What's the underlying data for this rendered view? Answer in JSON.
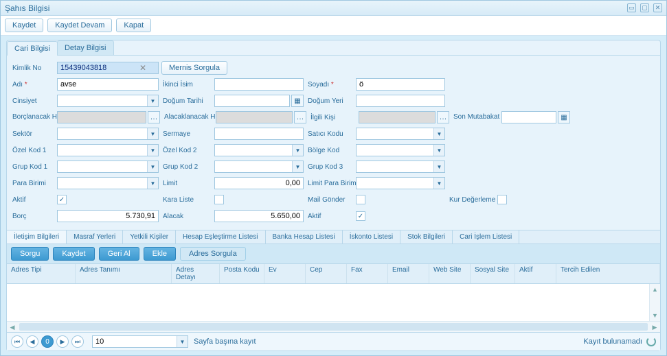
{
  "window": {
    "title": "Şahıs Bilgisi"
  },
  "toolbar": {
    "save": "Kaydet",
    "save_cont": "Kaydet Devam",
    "close": "Kapat"
  },
  "tabs": {
    "cari": "Cari Bilgisi",
    "detay": "Detay Bilgisi"
  },
  "form": {
    "kimlik_lbl": "Kimlik No",
    "kimlik_val": "15439043818",
    "mernis": "Mernis Sorgula",
    "adi_lbl": "Adı",
    "adi_val": "avse",
    "ikinci_lbl": "İkinci İsim",
    "ikinci_val": "",
    "soyadi_lbl": "Soyadı",
    "soyadi_val": "ö",
    "cinsiyet_lbl": "Cinsiyet",
    "cinsiyet_val": "",
    "dogum_tarihi_lbl": "Doğum Tarihi",
    "dogum_tarihi_val": "",
    "dogum_yeri_lbl": "Doğum Yeri",
    "dogum_yeri_val": "",
    "borclanacak_lbl": "Borçlanacak Hesap",
    "borclanacak_val": "",
    "alacaklanacak_lbl": "Alacaklanacak Hesap",
    "alacaklanacak_val": "",
    "ilgili_lbl": "İlgili Kişi",
    "ilgili_val": "",
    "mutabakat_lbl": "Son Mutabakat Tarihi",
    "mutabakat_val": "",
    "sektor_lbl": "Sektör",
    "sektor_val": "",
    "sermaye_lbl": "Sermaye",
    "sermaye_val": "",
    "satici_lbl": "Satıcı Kodu",
    "satici_val": "",
    "ozel1_lbl": "Özel Kod 1",
    "ozel1_val": "",
    "ozel2_lbl": "Özel Kod 2",
    "ozel2_val": "",
    "bolge_lbl": "Bölge Kod",
    "bolge_val": "",
    "grup1_lbl": "Grup Kod 1",
    "grup1_val": "",
    "grup2_lbl": "Grup Kod 2",
    "grup2_val": "",
    "grup3_lbl": "Grup Kod 3",
    "grup3_val": "",
    "para_lbl": "Para Birimi",
    "para_val": "",
    "limit_lbl": "Limit",
    "limit_val": "0,00",
    "limit_para_lbl": "Limit Para Birimi",
    "limit_para_val": "",
    "aktif_lbl": "Aktif",
    "kara_lbl": "Kara Liste",
    "mail_lbl": "Mail Gönder",
    "kur_lbl": "Kur Değerleme",
    "borc_lbl": "Borç",
    "borc_val": "5.730,91",
    "alacak_lbl": "Alacak",
    "alacak_val": "5.650,00",
    "aktif2_lbl": "Aktif"
  },
  "subtabs": {
    "iletisim": "İletişim Bilgileri",
    "masraf": "Masraf Yerleri",
    "yetkili": "Yetkili Kişiler",
    "hesap": "Hesap Eşleştirme Listesi",
    "banka": "Banka Hesap Listesi",
    "iskonto": "İskonto Listesi",
    "stok": "Stok Bilgileri",
    "islem": "Cari İşlem Listesi"
  },
  "subtoolbar": {
    "sorgu": "Sorgu",
    "kaydet": "Kaydet",
    "geri": "Geri Al",
    "ekle": "Ekle",
    "adres": "Adres Sorgula"
  },
  "grid": {
    "cols": [
      "Adres Tipi",
      "Adres Tanımı",
      "Adres Detayı",
      "Posta Kodu",
      "Ev",
      "Cep",
      "Fax",
      "Email",
      "Web Site",
      "Sosyal Site",
      "Aktif",
      "Tercih Edilen"
    ]
  },
  "pager": {
    "page": "0",
    "size": "10",
    "label": "Sayfa başına kayıt",
    "status": "Kayıt bulunamadı"
  }
}
